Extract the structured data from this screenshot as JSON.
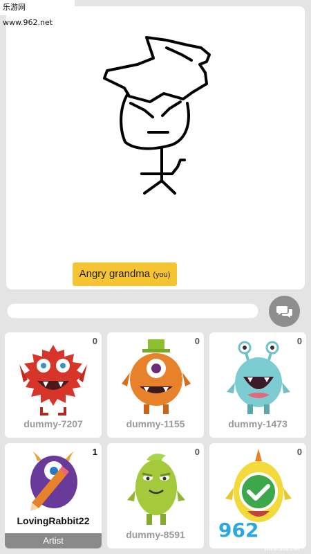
{
  "watermark_top": "乐游网 www.962.net",
  "watermark_bottom": {
    "number": "962",
    "net": ".NET",
    "chinese": "乐游网",
    "url": "www.962.net"
  },
  "word": {
    "label": "Angry grandma",
    "tag": "(you)"
  },
  "chat": {
    "button_icon": "chat-bubbles-icon"
  },
  "players": [
    {
      "name": "dummy-7207",
      "score": "0",
      "avatar": "red-monster"
    },
    {
      "name": "dummy-1155",
      "score": "0",
      "avatar": "orange-cyclops-monster"
    },
    {
      "name": "dummy-1473",
      "score": "0",
      "avatar": "teal-antenna-monster"
    },
    {
      "name": "LovingRabbit22",
      "score": "1",
      "avatar": "purple-monster-with-pencil",
      "role": "Artist"
    },
    {
      "name": "dummy-8591",
      "score": "0",
      "avatar": "green-monster"
    },
    {
      "name": "",
      "score": "0",
      "avatar": "yellow-monster-checkmark"
    }
  ],
  "colors": {
    "accent": "#f6c431",
    "background": "#e4e4e4"
  }
}
